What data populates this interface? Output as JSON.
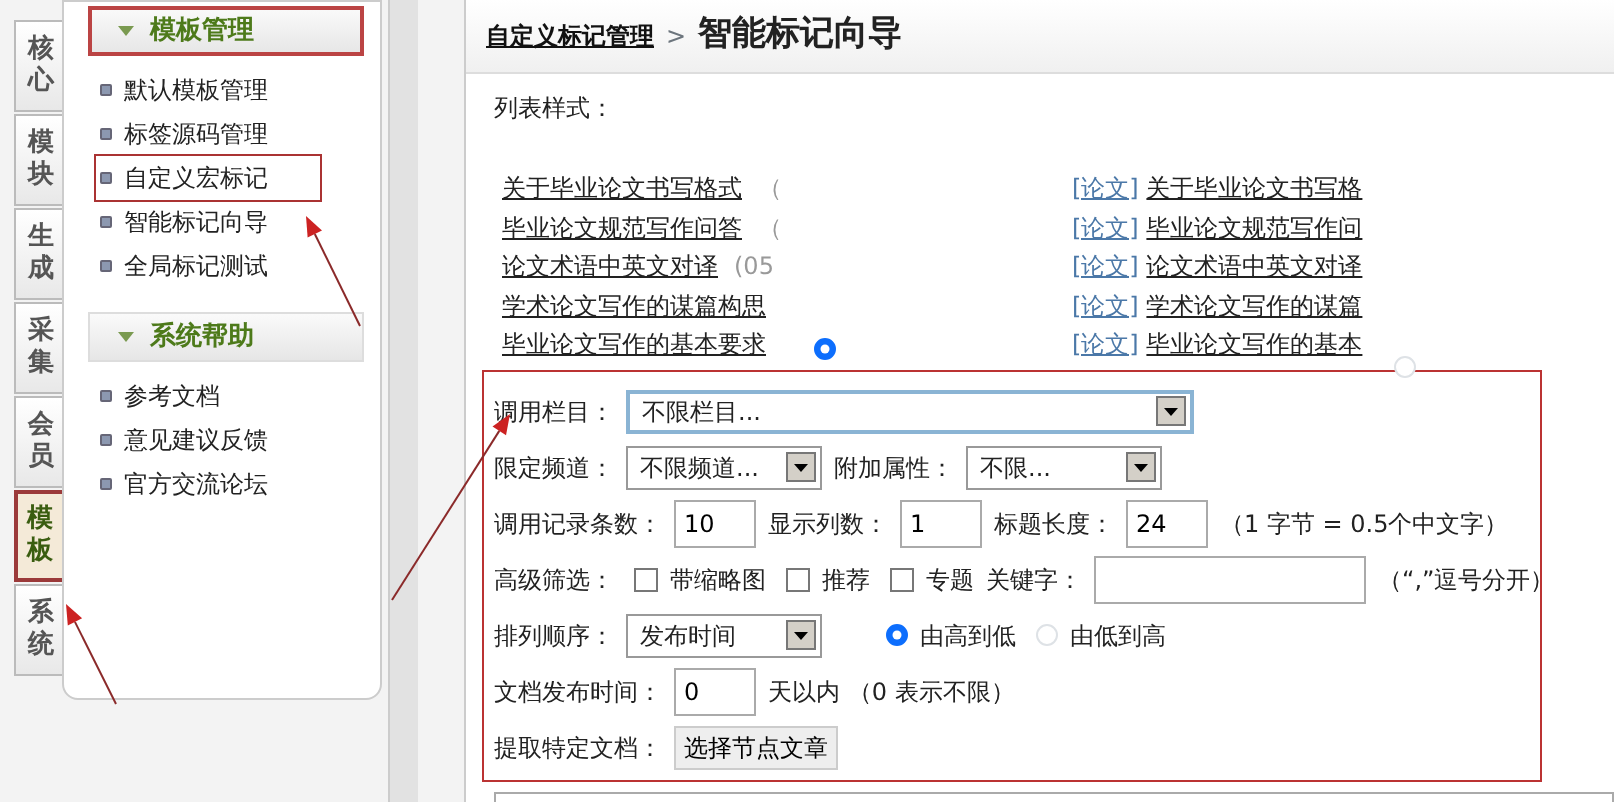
{
  "tabs": [
    {
      "label": "核心",
      "selected": false
    },
    {
      "label": "模块",
      "selected": false
    },
    {
      "label": "生成",
      "selected": false
    },
    {
      "label": "采集",
      "selected": false
    },
    {
      "label": "会员",
      "selected": false
    },
    {
      "label": "模板",
      "selected": true
    },
    {
      "label": "系统",
      "selected": false
    }
  ],
  "sidebar": {
    "sections": [
      {
        "title": "模板管理",
        "highlighted": true,
        "items": [
          {
            "label": "默认模板管理",
            "highlighted": false
          },
          {
            "label": "标签源码管理",
            "highlighted": false
          },
          {
            "label": "自定义宏标记",
            "highlighted": true
          },
          {
            "label": "智能标记向导",
            "highlighted": false
          },
          {
            "label": "全局标记测试",
            "highlighted": false
          }
        ]
      },
      {
        "title": "系统帮助",
        "highlighted": false,
        "items": [
          {
            "label": "参考文档",
            "highlighted": false
          },
          {
            "label": "意见建议反馈",
            "highlighted": false
          },
          {
            "label": "官方交流论坛",
            "highlighted": false
          }
        ]
      }
    ]
  },
  "breadcrumb": {
    "parent": "自定义标记管理",
    "separator": ">",
    "current": "智能标记向导"
  },
  "list_style": {
    "label": "列表样式：",
    "options": [
      {
        "selected": true,
        "items": [
          {
            "title": "关于毕业论文书写格式",
            "extra": "（"
          },
          {
            "title": "毕业论文规范写作问答",
            "extra": "（"
          },
          {
            "title": "论文术语中英文对译",
            "extra": "(05"
          },
          {
            "title": "学术论文写作的谋篇构思"
          },
          {
            "title": "毕业论文写作的基本要求"
          }
        ]
      },
      {
        "selected": false,
        "items": [
          {
            "tag": "[论文]",
            "title": "关于毕业论文书写格"
          },
          {
            "tag": "[论文]",
            "title": "毕业论文规范写作问"
          },
          {
            "tag": "[论文]",
            "title": "论文术语中英文对译"
          },
          {
            "tag": "[论文]",
            "title": "学术论文写作的谋篇"
          },
          {
            "tag": "[论文]",
            "title": "毕业论文写作的基本"
          }
        ]
      }
    ]
  },
  "form": {
    "highlighted": true,
    "rows": [
      {
        "fields": [
          {
            "kind": "label",
            "text": "调用栏目："
          },
          {
            "kind": "select",
            "value": "不限栏目..."
          }
        ]
      },
      {
        "fields": [
          {
            "kind": "label",
            "text": "限定频道："
          },
          {
            "kind": "select",
            "value": "不限频道..."
          },
          {
            "kind": "label",
            "text": "附加属性："
          },
          {
            "kind": "select",
            "value": "不限..."
          }
        ]
      },
      {
        "fields": [
          {
            "kind": "label",
            "text": "调用记录条数："
          },
          {
            "kind": "input",
            "value": "10"
          },
          {
            "kind": "label",
            "text": "显示列数："
          },
          {
            "kind": "input",
            "value": "1"
          },
          {
            "kind": "label",
            "text": "标题长度："
          },
          {
            "kind": "input",
            "value": "24"
          },
          {
            "kind": "note",
            "text": "（1 字节 = 0.5个中文字）"
          }
        ]
      },
      {
        "fields": [
          {
            "kind": "label",
            "text": "高级筛选："
          },
          {
            "kind": "checkbox",
            "text": "带缩略图",
            "checked": false
          },
          {
            "kind": "checkbox",
            "text": "推荐",
            "checked": false
          },
          {
            "kind": "checkbox",
            "text": "专题",
            "checked": false
          },
          {
            "kind": "label",
            "text": "关键字："
          },
          {
            "kind": "input"
          },
          {
            "kind": "note",
            "text": "（“,”逗号分开）"
          }
        ]
      },
      {
        "fields": [
          {
            "kind": "label",
            "text": "排列顺序："
          },
          {
            "kind": "select",
            "value": "发布时间"
          },
          {
            "kind": "radio",
            "text": "由高到低",
            "selected": true
          },
          {
            "kind": "radio",
            "text": "由低到高",
            "selected": false
          }
        ]
      },
      {
        "fields": [
          {
            "kind": "label",
            "text": "文档发布时间："
          },
          {
            "kind": "input",
            "value": "0"
          },
          {
            "kind": "note",
            "text": "天以内 （0 表示不限）"
          }
        ]
      },
      {
        "fields": [
          {
            "kind": "label",
            "text": "提取特定文档："
          },
          {
            "kind": "button",
            "text": "选择节点文章"
          }
        ]
      }
    ]
  }
}
